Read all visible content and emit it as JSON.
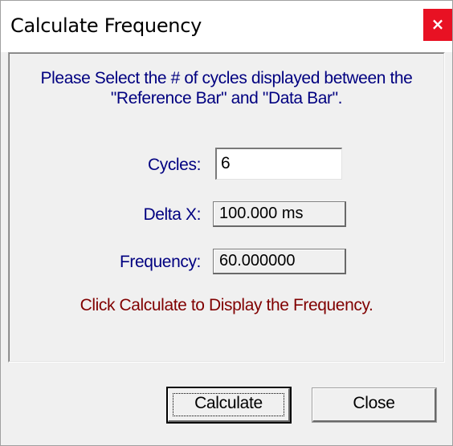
{
  "window": {
    "title": "Calculate Frequency",
    "close_glyph": "×"
  },
  "instruction": {
    "line1": "Please Select the # of cycles displayed between the",
    "line2": "\"Reference Bar\" and \"Data Bar\"."
  },
  "fields": {
    "cycles": {
      "label": "Cycles:",
      "value": "6"
    },
    "delta_x": {
      "label": "Delta X:",
      "value": "100.000 ms"
    },
    "frequency": {
      "label": "Frequency:",
      "value": "60.000000"
    }
  },
  "hint": "Click Calculate to Display the Frequency.",
  "buttons": {
    "calculate": "Calculate",
    "close": "Close"
  },
  "colors": {
    "label_text": "#000080",
    "hint_text": "#800000",
    "close_button_bg": "#e81123",
    "dialog_bg": "#f0f0f0"
  },
  "icons": {
    "title_close": "close-icon"
  }
}
